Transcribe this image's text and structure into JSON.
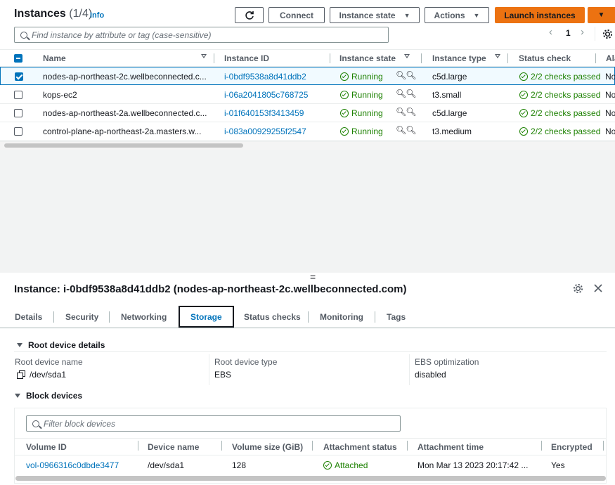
{
  "header": {
    "title": "Instances",
    "count": "(1/4)",
    "info": "Info",
    "refresh_icon": "refresh-icon",
    "buttons": {
      "connect": "Connect",
      "instance_state": "Instance state",
      "actions": "Actions",
      "launch": "Launch instances"
    },
    "accent": "#ec7211"
  },
  "search": {
    "placeholder": "Find instance by attribute or tag (case-sensitive)"
  },
  "pagination": {
    "prev": "‹",
    "page": "1",
    "next": "›"
  },
  "table": {
    "columns": [
      "Name",
      "Instance ID",
      "Instance state",
      "Instance type",
      "Status check",
      "Ala"
    ],
    "rows": [
      {
        "selected": true,
        "name": "nodes-ap-northeast-2c.wellbeconnected.c...",
        "id": "i-0bdf9538a8d41ddb2",
        "state": "Running",
        "type": "c5d.large",
        "status": "2/2 checks passed",
        "alarm": "No"
      },
      {
        "selected": false,
        "name": "kops-ec2",
        "id": "i-06a2041805c768725",
        "state": "Running",
        "type": "t3.small",
        "status": "2/2 checks passed",
        "alarm": "No"
      },
      {
        "selected": false,
        "name": "nodes-ap-northeast-2a.wellbeconnected.c...",
        "id": "i-01f640153f3413459",
        "state": "Running",
        "type": "c5d.large",
        "status": "2/2 checks passed",
        "alarm": "No"
      },
      {
        "selected": false,
        "name": "control-plane-ap-northeast-2a.masters.w...",
        "id": "i-083a00929255f2547",
        "state": "Running",
        "type": "t3.medium",
        "status": "2/2 checks passed",
        "alarm": "No"
      }
    ],
    "status_color": "#1d8102"
  },
  "detail": {
    "split_handle": "=",
    "title": "Instance: i-0bdf9538a8d41ddb2 (nodes-ap-northeast-2c.wellbeconnected.com)",
    "tabs": [
      "Details",
      "Security",
      "Networking",
      "Storage",
      "Status checks",
      "Monitoring",
      "Tags"
    ],
    "active_tab": "Storage",
    "root_section": "Root device details",
    "root": {
      "name_label": "Root device name",
      "name_value": "/dev/sda1",
      "type_label": "Root device type",
      "type_value": "EBS",
      "ebs_label": "EBS optimization",
      "ebs_value": "disabled"
    },
    "block_section": "Block devices",
    "block_filter_placeholder": "Filter block devices",
    "block_columns": [
      "Volume ID",
      "Device name",
      "Volume size (GiB)",
      "Attachment status",
      "Attachment time",
      "Encrypted"
    ],
    "block_rows": [
      {
        "volume_id": "vol-0966316c0dbde3477",
        "device": "/dev/sda1",
        "size": "128",
        "status": "Attached",
        "time": "Mon Mar 13 2023 20:17:42 ...",
        "encrypted": "Yes"
      }
    ]
  }
}
